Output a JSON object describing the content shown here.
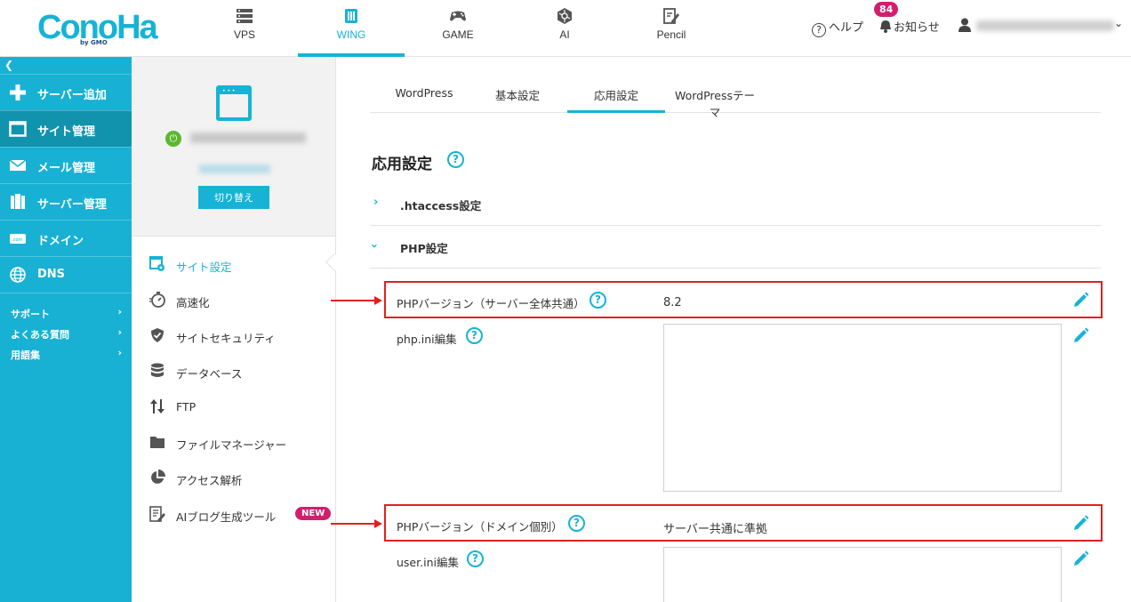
{
  "brand": {
    "name": "ConoHa",
    "by": "by GMO"
  },
  "nav": {
    "tabs": [
      {
        "label": "VPS",
        "icon": "server-icon"
      },
      {
        "label": "WING",
        "icon": "wing-icon",
        "active": true
      },
      {
        "label": "GAME",
        "icon": "gamepad-icon"
      },
      {
        "label": "AI",
        "icon": "ai-icon"
      },
      {
        "label": "Pencil",
        "icon": "pencil-doc-icon"
      }
    ],
    "help_label": "ヘルプ",
    "notice_label": "お知らせ",
    "notice_count": "84"
  },
  "sidebar": {
    "items": [
      {
        "label": "サーバー追加",
        "icon": "plus-icon"
      },
      {
        "label": "サイト管理",
        "icon": "window-icon",
        "active": true
      },
      {
        "label": "メール管理",
        "icon": "mail-icon"
      },
      {
        "label": "サーバー管理",
        "icon": "server-manage-icon"
      },
      {
        "label": "ドメイン",
        "icon": "domain-icon"
      },
      {
        "label": "DNS",
        "icon": "globe-icon"
      }
    ],
    "links": [
      {
        "label": "サポート"
      },
      {
        "label": "よくある質問"
      },
      {
        "label": "用語集"
      }
    ]
  },
  "site_panel": {
    "switch_label": "切り替え",
    "menu": [
      {
        "label": "サイト設定",
        "icon": "site-settings-icon",
        "active": true
      },
      {
        "label": "高速化",
        "icon": "speed-icon"
      },
      {
        "label": "サイトセキュリティ",
        "icon": "shield-icon"
      },
      {
        "label": "データベース",
        "icon": "database-icon"
      },
      {
        "label": "FTP",
        "icon": "ftp-icon"
      },
      {
        "label": "ファイルマネージャー",
        "icon": "folder-icon"
      },
      {
        "label": "アクセス解析",
        "icon": "pie-chart-icon"
      },
      {
        "label": "AIブログ生成ツール",
        "icon": "ai-blog-icon",
        "badge": "NEW"
      }
    ]
  },
  "main": {
    "tabs": [
      {
        "label": "WordPress"
      },
      {
        "label": "基本設定"
      },
      {
        "label": "応用設定",
        "active": true
      },
      {
        "label": "WordPressテーマ"
      }
    ],
    "section_title": "応用設定",
    "accordions": [
      {
        "label": ".htaccess設定",
        "chevron": "›",
        "expanded": false
      },
      {
        "label": "PHP設定",
        "chevron": "›",
        "expanded": true
      }
    ],
    "fields": {
      "php_version_server_label": "PHPバージョン（サーバー全体共通）",
      "php_version_server_value": "8.2",
      "php_ini_label": "php.ini編集",
      "php_version_domain_label": "PHPバージョン（ドメイン個別）",
      "php_version_domain_value": "サーバー共通に準拠",
      "user_ini_label": "user.ini編集"
    }
  },
  "colors": {
    "accent": "#16b3d6",
    "sidebar": "#18b1d3",
    "sidebar_active": "#1193ad",
    "badge": "#d01f6d",
    "highlight": "#e02020",
    "power": "#5bb82e"
  }
}
